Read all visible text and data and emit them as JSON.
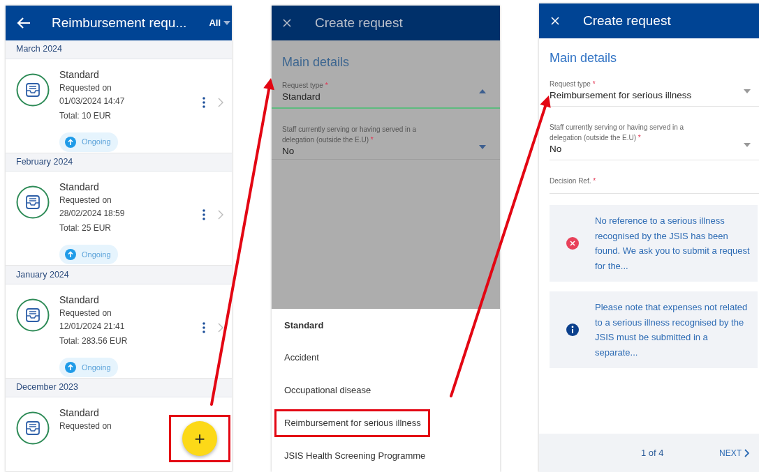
{
  "list_screen": {
    "title": "Reimbursement requ...",
    "filter": "All",
    "groups": [
      {
        "month": "March 2024",
        "requests": [
          {
            "type": "Standard",
            "requested_label": "Requested on",
            "date": "01/03/2024 14:47",
            "total": "Total: 10 EUR",
            "status": "Ongoing"
          }
        ]
      },
      {
        "month": "February 2024",
        "requests": [
          {
            "type": "Standard",
            "requested_label": "Requested on",
            "date": "28/02/2024 18:59",
            "total": "Total: 25 EUR",
            "status": "Ongoing"
          }
        ]
      },
      {
        "month": "January 2024",
        "requests": [
          {
            "type": "Standard",
            "requested_label": "Requested on",
            "date": "12/01/2024 21:41",
            "total": "Total: 283.56 EUR",
            "status": "Ongoing"
          }
        ]
      },
      {
        "month": "December 2023",
        "requests": [
          {
            "type": "Standard",
            "requested_label": "Requested on"
          }
        ]
      }
    ],
    "fab": {
      "label": "+",
      "highlighted": true
    }
  },
  "dropdown_screen": {
    "title": "Create request",
    "dimmed": true,
    "section": "Main details",
    "fields": [
      {
        "label": "Request type",
        "required_mark": "*",
        "value": "Standard",
        "expanded": true,
        "focused": true
      },
      {
        "label": "Staff currently serving or having served in a delegation (outside the E.U)",
        "required_mark": "*",
        "value": "No",
        "expanded": false,
        "focused": false
      }
    ],
    "options": [
      {
        "label": "Standard",
        "selected": true,
        "highlighted": false
      },
      {
        "label": "Accident",
        "selected": false,
        "highlighted": false
      },
      {
        "label": "Occupational disease",
        "selected": false,
        "highlighted": false
      },
      {
        "label": "Reimbursement for serious illness",
        "selected": false,
        "highlighted": true
      },
      {
        "label": "JSIS Health Screening Programme",
        "selected": false,
        "highlighted": false
      }
    ]
  },
  "form_screen": {
    "title": "Create request",
    "section": "Main details",
    "fields": [
      {
        "label": "Request type",
        "required_mark": "*",
        "value": "Reimbursement for serious illness"
      },
      {
        "label": "Staff currently serving or having served in a delegation (outside the E.U)",
        "required_mark": "*",
        "value": "No"
      },
      {
        "label": "Decision Ref.",
        "required_mark": "*"
      }
    ],
    "alerts": [
      {
        "kind": "error",
        "text": "No reference to a serious illness recognised by the JSIS has been found. We ask you to submit a request for the..."
      },
      {
        "kind": "info",
        "text": "Please note that expenses not related to a serious illness recognised by the JSIS must be submitted in a separate..."
      }
    ],
    "pager": {
      "position": "1 of 4",
      "next": "NEXT"
    }
  }
}
